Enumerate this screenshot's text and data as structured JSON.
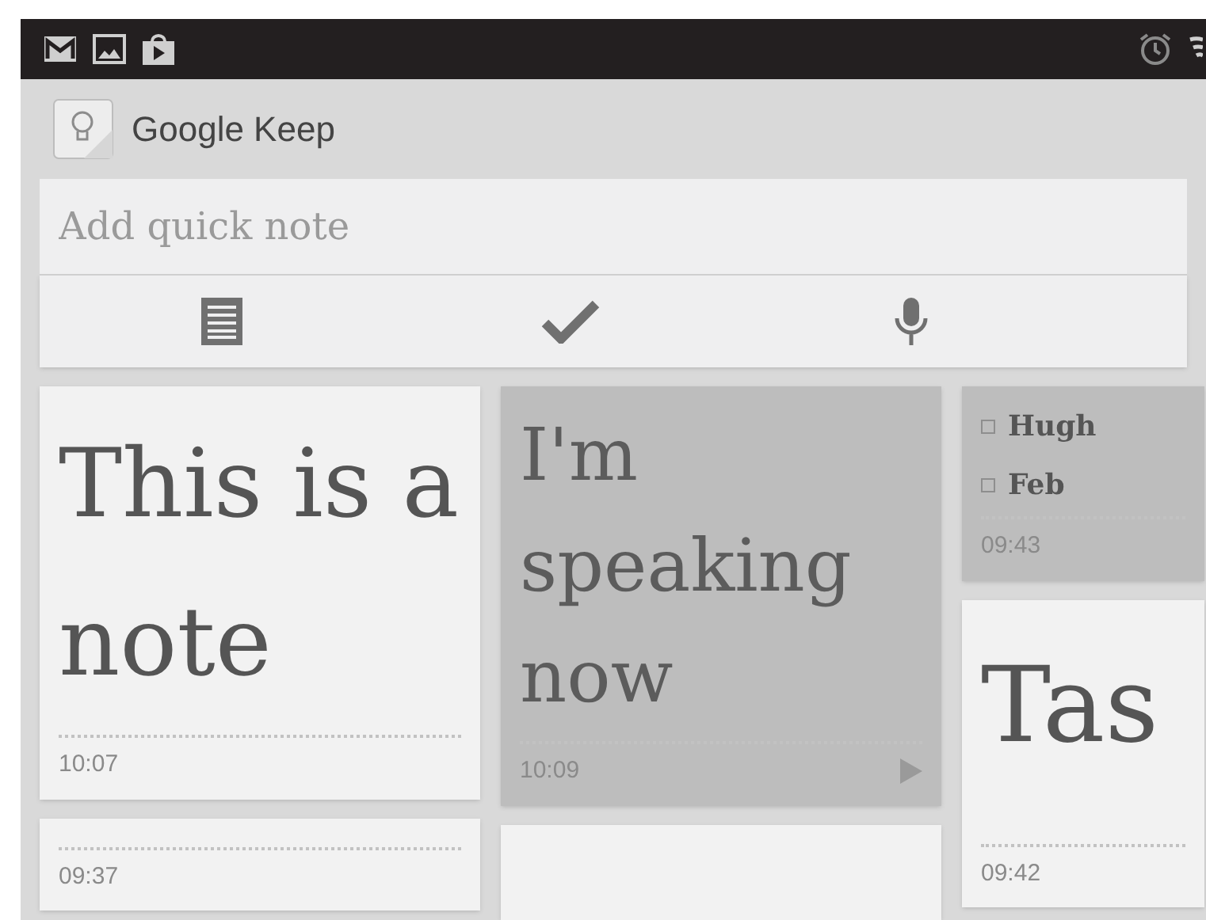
{
  "app_bar": {
    "title": "Google Keep"
  },
  "quick_note": {
    "placeholder": "Add quick note"
  },
  "columns": [
    {
      "notes": [
        {
          "kind": "text",
          "color": "#f2f2f2",
          "text": "This is a note",
          "time": "10:07"
        },
        {
          "kind": "blank",
          "color": "#f2f2f2",
          "time": "09:37"
        }
      ]
    },
    {
      "notes": [
        {
          "kind": "voice",
          "color": "#bdbdbd",
          "text": "I'm speaking now",
          "time": "10:09"
        },
        {
          "kind": "blank",
          "color": "#f2f2f2"
        }
      ]
    },
    {
      "notes": [
        {
          "kind": "checklist",
          "color": "#bdbdbd",
          "items": [
            {
              "label": "Hugh",
              "checked": false
            },
            {
              "label": "Feb",
              "checked": false
            }
          ],
          "time": "09:43"
        },
        {
          "kind": "title",
          "color": "#f2f2f2",
          "text": "Tas",
          "time": "09:42"
        }
      ]
    }
  ]
}
